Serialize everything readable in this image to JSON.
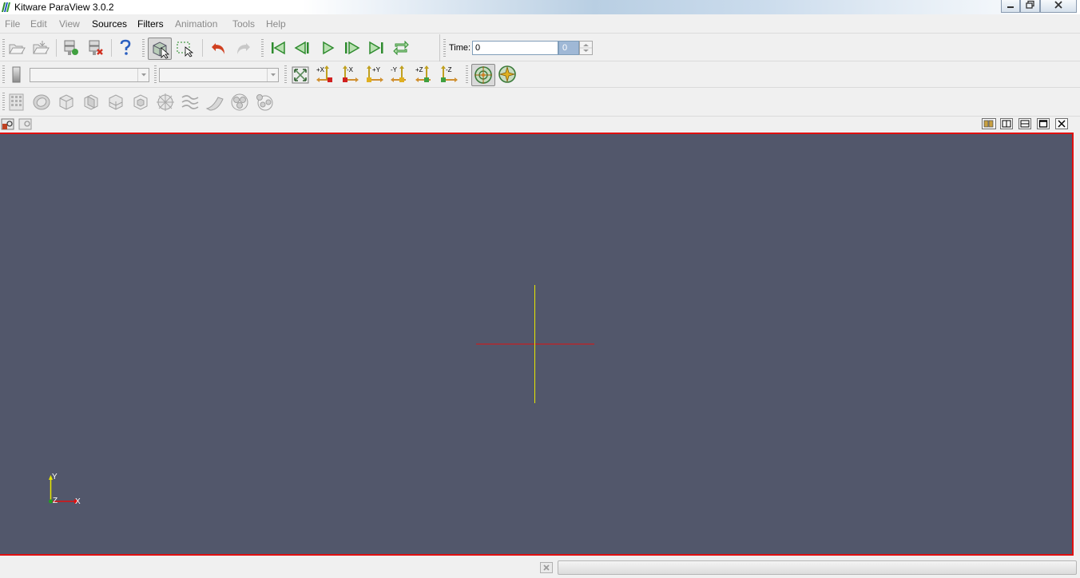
{
  "window": {
    "title": "Kitware ParaView 3.0.2",
    "controls": [
      "minimize-icon",
      "maximize-icon",
      "close-icon"
    ]
  },
  "menubar": {
    "items": [
      {
        "label": "File",
        "enabled": false
      },
      {
        "label": "Edit",
        "enabled": false
      },
      {
        "label": "View",
        "enabled": false
      },
      {
        "label": "Sources",
        "enabled": true
      },
      {
        "label": "Filters",
        "enabled": true
      },
      {
        "label": "Animation",
        "enabled": false
      },
      {
        "label": "Tools",
        "enabled": false
      },
      {
        "label": "Help",
        "enabled": false
      }
    ]
  },
  "toolbar_main": {
    "icons": [
      "open-file-icon",
      "open-recent-icon",
      "connect-server-icon",
      "disconnect-server-icon",
      "help-icon",
      "interact-mode-icon",
      "select-region-icon",
      "undo-icon",
      "redo-icon"
    ]
  },
  "animation": {
    "icons": [
      "first-frame-icon",
      "previous-frame-icon",
      "play-icon",
      "next-frame-icon",
      "last-frame-icon",
      "loop-icon"
    ],
    "time_label": "Time:",
    "time_value": "0",
    "time_step": "0"
  },
  "camera_toolbar": {
    "reset_icon": "reset-camera-icon",
    "view_buttons": [
      {
        "label": "+X",
        "icon": "view-plus-x-icon"
      },
      {
        "label": "-X",
        "icon": "view-minus-x-icon"
      },
      {
        "label": "+Y",
        "icon": "view-plus-y-icon"
      },
      {
        "label": "-Y",
        "icon": "view-minus-y-icon"
      },
      {
        "label": "+Z",
        "icon": "view-plus-z-icon"
      },
      {
        "label": "-Z",
        "icon": "view-minus-z-icon"
      }
    ],
    "center_icons": [
      "show-center-icon",
      "reset-center-icon"
    ]
  },
  "common_filters": {
    "icons": [
      "calculator-icon",
      "contour-icon",
      "clip-icon",
      "slice-icon",
      "threshold-icon",
      "extract-subset-icon",
      "glyph-icon",
      "stream-tracer-icon",
      "warp-vector-icon",
      "group-datasets-icon",
      "extract-level-icon"
    ]
  },
  "view_bar": {
    "left_icons": [
      "view-manage-icon",
      "view-lookmark-icon"
    ],
    "right_icons": [
      "view-options-icon",
      "split-horizontal-icon",
      "split-vertical-icon",
      "maximize-view-icon",
      "close-view-icon"
    ]
  },
  "viewport": {
    "background": "#52576b",
    "border_color": "#e01010",
    "orientation_axes": {
      "x": "X",
      "y": "Y",
      "z": "Z"
    },
    "center_axes_colors": {
      "x": "#e01010",
      "y": "#e8e800"
    }
  },
  "statusbar": {
    "progress": 0
  }
}
